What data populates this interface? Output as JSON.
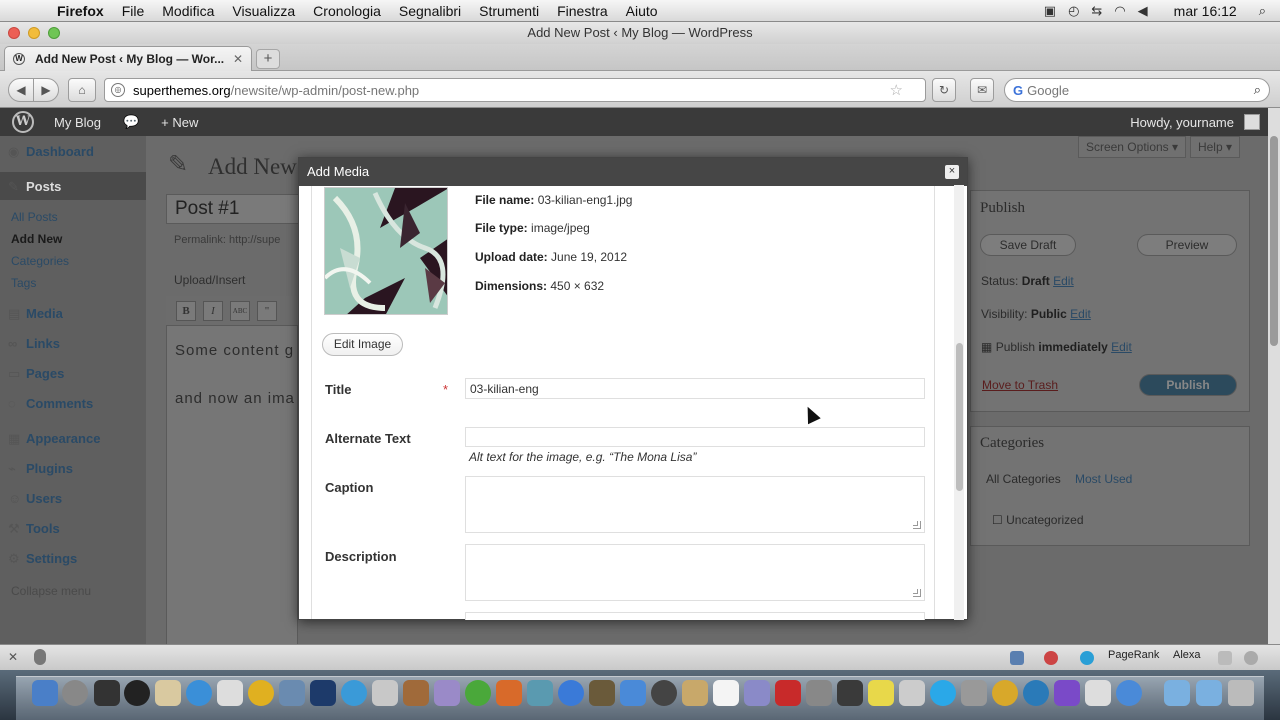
{
  "menubar": {
    "app": "Firefox",
    "items": [
      "File",
      "Modifica",
      "Visualizza",
      "Cronologia",
      "Segnalibri",
      "Strumenti",
      "Finestra",
      "Aiuto"
    ],
    "clock": "mar 16:12"
  },
  "window": {
    "title": "Add New Post ‹ My Blog — WordPress"
  },
  "tabs": [
    {
      "label": "Add New Post ‹ My Blog — Wor..."
    }
  ],
  "newtab_label": "+",
  "urlbar": {
    "host": "superthemes.org",
    "path": "/newsite/wp-admin/post-new.php"
  },
  "searchbox": {
    "placeholder": "Google"
  },
  "wpadminbar": {
    "site": "My Blog",
    "new": "New",
    "howdy": "Howdy, yourname"
  },
  "sidebar": {
    "dashboard": "Dashboard",
    "posts": "Posts",
    "posts_sub": [
      "All Posts",
      "Add New",
      "Categories",
      "Tags"
    ],
    "media": "Media",
    "links": "Links",
    "pages": "Pages",
    "comments": "Comments",
    "appearance": "Appearance",
    "plugins": "Plugins",
    "users": "Users",
    "tools": "Tools",
    "settings": "Settings",
    "collapse": "Collapse menu"
  },
  "editor_bg": {
    "page_title": "Add New",
    "post_title": "Post #1",
    "permalink": "Permalink: http://supe",
    "upload_insert": "Upload/Insert",
    "toolbar": [
      "B",
      "I",
      "ABC",
      "\""
    ],
    "content_line1": "Some content g",
    "content_line2": "and now an ima",
    "screen_options": "Screen Options ▾",
    "help": "Help ▾"
  },
  "publish_box": {
    "title": "Publish",
    "save_draft": "Save Draft",
    "preview": "Preview",
    "status_label": "Status:",
    "status_value": "Draft",
    "visibility_label": "Visibility:",
    "visibility_value": "Public",
    "publish_label": "Publish",
    "publish_value": "immediately",
    "edit": "Edit",
    "trash": "Move to Trash",
    "publish_btn": "Publish"
  },
  "categories_box": {
    "title": "Categories",
    "tab_all": "All Categories",
    "tab_used": "Most Used",
    "item": "Uncategorized"
  },
  "modal": {
    "title": "Add Media",
    "close": "×",
    "meta": {
      "file_name_label": "File name:",
      "file_name": "03-kilian-eng1.jpg",
      "file_type_label": "File type:",
      "file_type": "image/jpeg",
      "upload_date_label": "Upload date:",
      "upload_date": "June 19, 2012",
      "dimensions_label": "Dimensions:",
      "dimensions": "450 × 632"
    },
    "edit_image": "Edit Image",
    "fields": {
      "title_label": "Title",
      "title_required": "*",
      "title_value": "03-kilian-eng",
      "alt_label": "Alternate Text",
      "alt_value": "",
      "alt_help": "Alt text for the image, e.g. “The Mona Lisa”",
      "caption_label": "Caption",
      "description_label": "Description"
    }
  },
  "addonbar": {
    "pagerank": "PageRank",
    "alexa": "Alexa"
  },
  "colors": {
    "wp_bar": "#3a3a3a",
    "modal_header": "#464646",
    "link": "#21759b",
    "required": "#cc3333"
  }
}
